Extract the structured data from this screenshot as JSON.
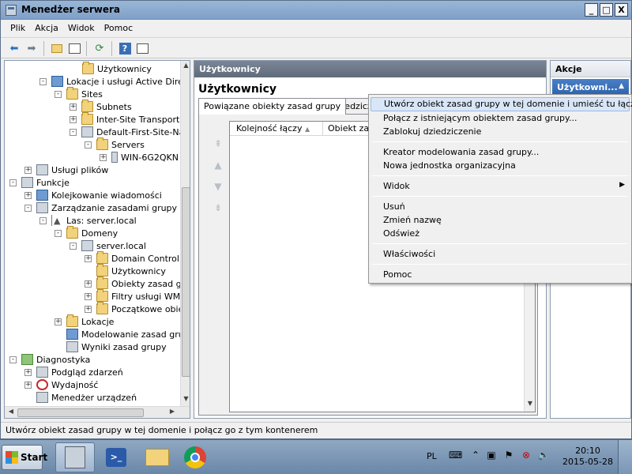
{
  "window": {
    "title": "Menedżer serwera",
    "buttons": [
      "_",
      "□",
      "X"
    ]
  },
  "menu": [
    "Plik",
    "Akcja",
    "Widok",
    "Pomoc"
  ],
  "tree": {
    "items": [
      {
        "label": "Użytkownicy",
        "expander": ""
      },
      {
        "label": "Lokacje i usługi Active Directo",
        "expander": "-"
      },
      {
        "label": "Sites",
        "expander": "-"
      },
      {
        "label": "Subnets",
        "expander": "+"
      },
      {
        "label": "Inter-Site Transports",
        "expander": "+"
      },
      {
        "label": "Default-First-Site-Nar",
        "expander": "-"
      },
      {
        "label": "Servers",
        "expander": "-"
      },
      {
        "label": "WIN-6G2QKN",
        "expander": "+"
      },
      {
        "label": "Usługi plików",
        "expander": "+"
      },
      {
        "label": "Funkcje",
        "expander": "-"
      },
      {
        "label": "Kolejkowanie wiadomości",
        "expander": "+"
      },
      {
        "label": "Zarządzanie zasadami grupy",
        "expander": "-"
      },
      {
        "label": "Las: server.local",
        "expander": "-"
      },
      {
        "label": "Domeny",
        "expander": "-"
      },
      {
        "label": "server.local",
        "expander": "-"
      },
      {
        "label": "Domain Controlle",
        "expander": "+"
      },
      {
        "label": "Użytkownicy",
        "expander": ""
      },
      {
        "label": "Obiekty zasad gr",
        "expander": "+"
      },
      {
        "label": "Filtry usługi WMI",
        "expander": "+"
      },
      {
        "label": "Początkowe obiel",
        "expander": "+"
      },
      {
        "label": "Lokacje",
        "expander": "+"
      },
      {
        "label": "Modelowanie zasad grupy",
        "expander": ""
      },
      {
        "label": "Wyniki zasad grupy",
        "expander": ""
      },
      {
        "label": "Diagnostyka",
        "expander": "-"
      },
      {
        "label": "Podgląd zdarzeń",
        "expander": "+"
      },
      {
        "label": "Wydajność",
        "expander": "+"
      },
      {
        "label": "Menedżer urządzeń",
        "expander": ""
      }
    ]
  },
  "center": {
    "header": "Użytkownicy",
    "title": "Użytkownicy",
    "tabs": [
      "Powiązane obiekty zasad grupy",
      "Dziedzicze"
    ],
    "columns": [
      "Kolejność łączy",
      "Obiekt zasa"
    ]
  },
  "actions": {
    "header": "Akcje",
    "selected": "Użytkowni..."
  },
  "context_menu": {
    "items": [
      "Utwórz obiekt zasad grupy w tej domenie i umieść tu łącze...",
      "Połącz z istniejącym obiektem zasad grupy...",
      "Zablokuj dziedziczenie",
      "Kreator modelowania zasad grupy...",
      "Nowa jednostka organizacyjna",
      "Widok",
      "Usuń",
      "Zmień nazwę",
      "Odśwież",
      "Właściwości",
      "Pomoc"
    ]
  },
  "status": "Utwórz obiekt zasad grupy w tej domenie i połącz go z tym kontenerem",
  "taskbar": {
    "start": "Start",
    "lang": "PL",
    "time": "20:10",
    "date": "2015-05-28"
  },
  "colors": {
    "titlebar": "#8fadd0",
    "selection": "#2c63ae",
    "pane_header": "#6b7785"
  }
}
